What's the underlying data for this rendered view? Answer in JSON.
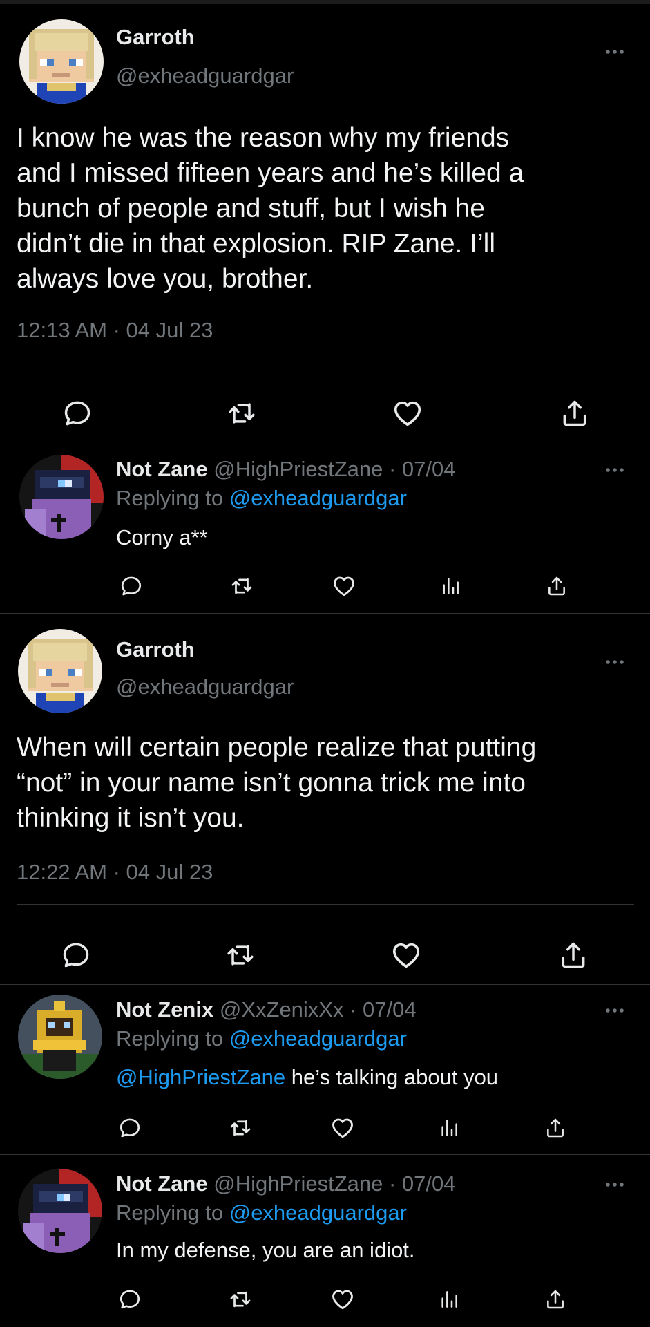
{
  "tweets": [
    {
      "name": "Garroth",
      "handle": "@exheadguardgar",
      "text_lines": [
        "I know he was the reason why my friends",
        "and I missed fifteen years and he’s killed a",
        "bunch of people and stuff, but I wish he",
        "didn’t die in that explosion. RIP Zane. I’ll",
        "always love you, brother."
      ],
      "time": "12:13 AM · 04 Jul 23"
    },
    {
      "name": "Garroth",
      "handle": "@exheadguardgar",
      "text_lines": [
        "When will certain people realize that putting",
        "“not” in your name isn’t gonna trick me into",
        "thinking it isn’t you."
      ],
      "time": "12:22 AM · 04 Jul 23"
    }
  ],
  "replies": [
    {
      "name": "Not Zane",
      "handle": "@HighPriestZane",
      "date": "· 07/04",
      "replying_prefix": "Replying to",
      "replying_to": "@exheadguardgar",
      "mention": "",
      "text": "Corny a**"
    },
    {
      "name": "Not Zenix",
      "handle": "@XxZenixXx",
      "date": "· 07/04",
      "replying_prefix": "Replying to",
      "replying_to": "@exheadguardgar",
      "mention": "@HighPriestZane",
      "text": " he’s talking about you"
    },
    {
      "name": "Not Zane",
      "handle": "@HighPriestZane",
      "date": "· 07/04",
      "replying_prefix": "Replying to",
      "replying_to": "@exheadguardgar",
      "mention": "",
      "text": "In my defense, you are an idiot."
    }
  ],
  "icons": {
    "more": "more-horizontal-icon",
    "reply": "reply-bubble-icon",
    "retweet": "retweet-icon",
    "like": "heart-icon",
    "views": "views-bar-chart-icon",
    "share": "share-icon"
  },
  "colors": {
    "background": "#000000",
    "text": "#e7e9ea",
    "muted": "#71767b",
    "link": "#1d9bf0",
    "separator": "#2f3336"
  }
}
